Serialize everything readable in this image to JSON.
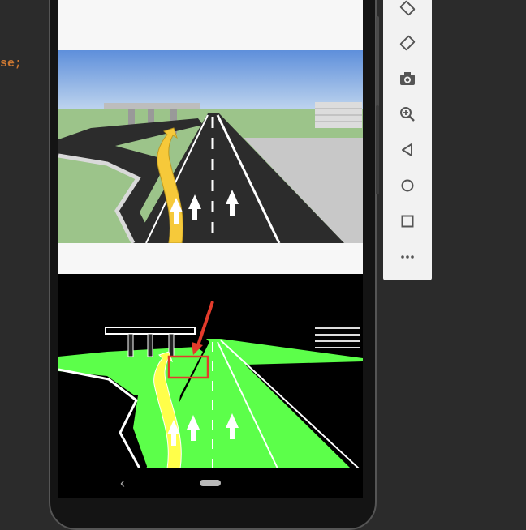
{
  "editor": {
    "code_fragment": "se;"
  },
  "emulator_toolbar": {
    "tools": [
      {
        "icon": "rotate-left-icon"
      },
      {
        "icon": "rotate-right-icon"
      },
      {
        "icon": "camera-icon"
      },
      {
        "icon": "zoom-in-icon"
      },
      {
        "icon": "back-icon"
      },
      {
        "icon": "home-icon"
      },
      {
        "icon": "overview-icon"
      },
      {
        "icon": "more-icon"
      }
    ]
  },
  "device": {
    "nav_bar": {
      "back_label": "‹"
    }
  },
  "colors": {
    "sky": "#7aa9e2",
    "grass": "#9cc48a",
    "road": "#2c2c2c",
    "arrow_yellow": "#f6c93a",
    "edge_green": "#5cff4a",
    "annotation_red": "#e33b2b"
  }
}
